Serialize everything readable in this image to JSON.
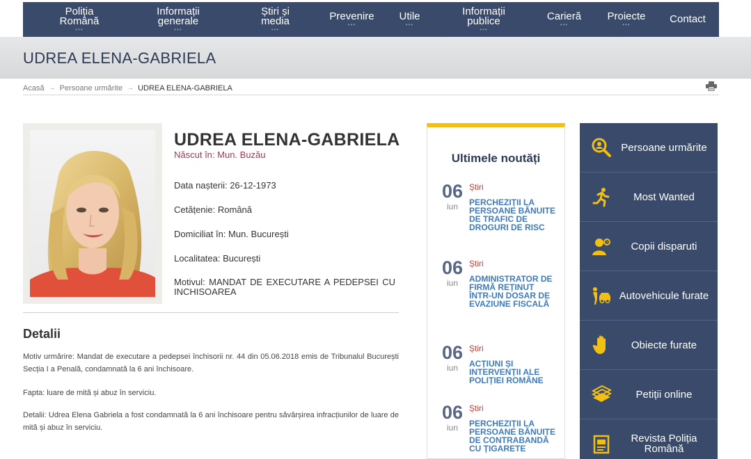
{
  "nav": [
    {
      "label": "Poliția\nRomână"
    },
    {
      "label": "Informații\ngenerale"
    },
    {
      "label": "Știri și\nmedia"
    },
    {
      "label": "Prevenire"
    },
    {
      "label": "Utile"
    },
    {
      "label": "Informații\npublice"
    },
    {
      "label": "Carieră"
    },
    {
      "label": "Proiecte"
    },
    {
      "label": "Contact"
    }
  ],
  "nav_dots": "•••",
  "banner_title": "UDREA ELENA-GABRIELA",
  "breadcrumb": {
    "home": "Acasă",
    "section": "Persoane urmărite",
    "current": "UDREA ELENA-GABRIELA",
    "separator": "→"
  },
  "person": {
    "name": "UDREA ELENA-GABRIELA",
    "born": "Născut în: Mun. Buzău",
    "birth_date": "Data nașterii: 26-12-1973",
    "citizenship": "Cetățenie: Română",
    "domicile": "Domiciliat în: Mun. București",
    "locality": "Localitatea: București",
    "reason": "Motivul: MANDAT DE EXECUTARE A PEDEPSEI CU INCHISOAREA"
  },
  "details": {
    "title": "Detalii",
    "p1": "Motiv urmărire: Mandat de executare a pedepsei închisorii nr. 44 din 05.06.2018 emis de Tribunalul București Secția I a Penală, condamnată la 6 ani închisoare.",
    "p2": "Fapta: luare de mită și abuz în serviciu.",
    "p3": "Detalii: Udrea Elena Gabriela a fost condamnată la 6 ani închisoare pentru săvârșirea infracțiunilor de luare de mită și abuz în serviciu."
  },
  "news": {
    "title": "Ultimele noutăți",
    "items": [
      {
        "day": "06",
        "month": "iun",
        "category": "Știri",
        "title": "PERCHEZIȚII LA PERSOANE BĂNUITE DE TRAFIC DE DROGURI DE RISC"
      },
      {
        "day": "06",
        "month": "iun",
        "category": "Știri",
        "title": "ADMINISTRATOR DE FIRMĂ REȚINUT ÎNTR-UN DOSAR DE EVAZIUNE FISCALĂ"
      },
      {
        "day": "06",
        "month": "iun",
        "category": "Știri",
        "title": "ACȚIUNI ȘI INTERVENȚII ALE POLIȚIEI ROMÂNE"
      },
      {
        "day": "06",
        "month": "iun",
        "category": "Știri",
        "title": "PERCHEZIȚII LA PERSOANE BĂNUITE DE CONTRABANDĂ CU ȚIGARETE"
      }
    ]
  },
  "side_menu": [
    {
      "label": "Persoane urmărite",
      "icon": "search-person-icon"
    },
    {
      "label": "Most Wanted",
      "icon": "running-person-icon"
    },
    {
      "label": "Copii disparuti",
      "icon": "child-icon"
    },
    {
      "label": "Autovehicule furate",
      "icon": "car-thief-icon"
    },
    {
      "label": "Obiecte furate",
      "icon": "hand-icon"
    },
    {
      "label": "Petiții online",
      "icon": "documents-icon"
    },
    {
      "label": "Revista Poliția Română",
      "icon": "magazine-icon"
    }
  ],
  "colors": {
    "nav_bg": "#3a4a6b",
    "accent": "#f2c014",
    "link": "#3d7ac0",
    "born": "#9b3c4c"
  }
}
